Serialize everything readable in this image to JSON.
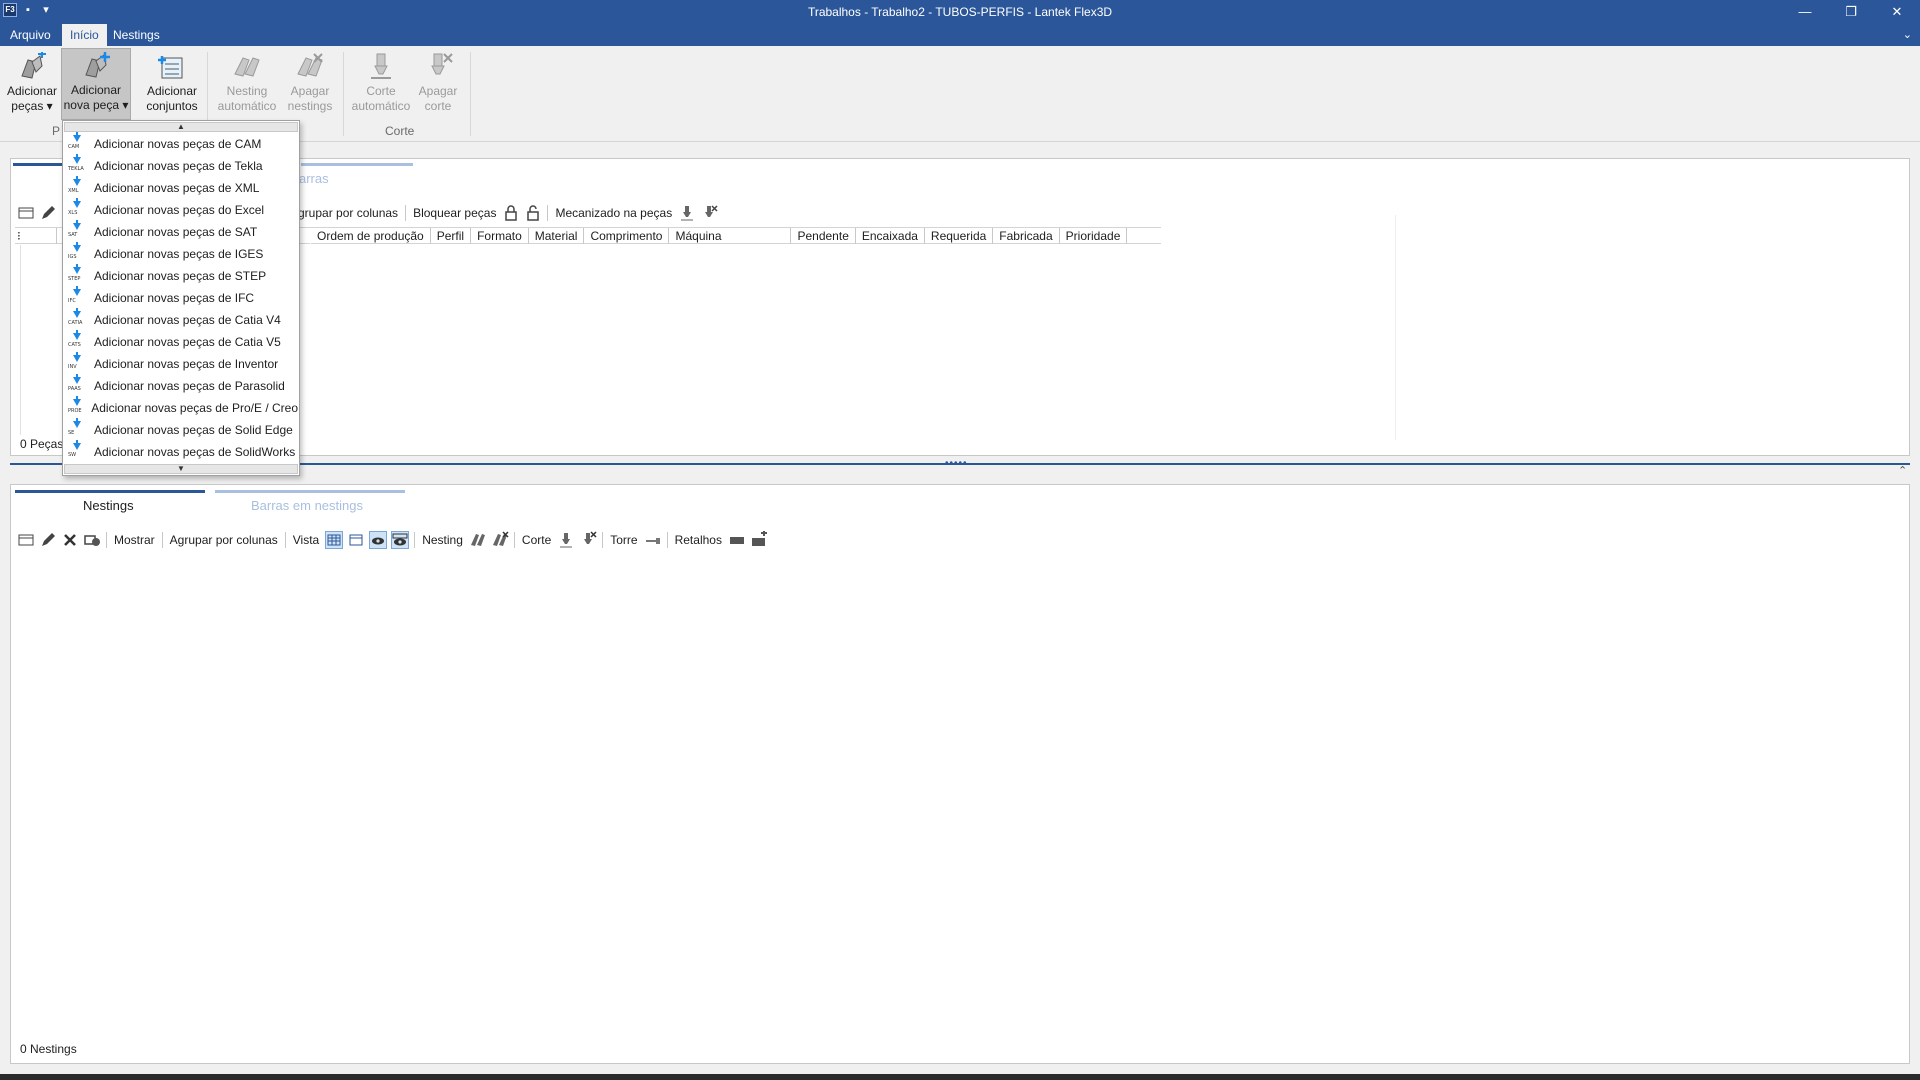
{
  "window": {
    "title": "Trabalhos - Trabalho2 - TUBOS-PERFIS - Lantek Flex3D",
    "app_icon_text": "F3"
  },
  "menu": {
    "tabs": [
      "Arquivo",
      "Início",
      "Nestings"
    ],
    "active": "Início"
  },
  "ribbon": {
    "add_parts": {
      "line1": "Adicionar",
      "line2": "peças ▾"
    },
    "add_new_part": {
      "line1": "Adicionar",
      "line2": "nova peça ▾"
    },
    "add_assemblies": {
      "line1": "Adicionar",
      "line2": "conjuntos"
    },
    "auto_nesting": {
      "line1": "Nesting",
      "line2": "automático"
    },
    "delete_nestings": {
      "line1": "Apagar",
      "line2": "nestings"
    },
    "auto_cut": {
      "line1": "Corte",
      "line2": "automático"
    },
    "delete_cut": {
      "line1": "Apagar",
      "line2": "corte"
    },
    "group_parts_label": "P",
    "group_cut_label": "Corte"
  },
  "parts_panel": {
    "tab2_partial": "arras",
    "toolbar": {
      "group_by_columns_partial": "grupar por colunas",
      "lock_parts": "Bloquear peças",
      "machined_in_parts": "Mecanizado na peças"
    },
    "columns": [
      "Ordem de produção",
      "Perfil",
      "Formato",
      "Material",
      "Comprimento",
      "Máquina",
      "Pendente",
      "Encaixada",
      "Requerida",
      "Fabricada",
      "Prioridade"
    ],
    "footer_partial": "0 Peças"
  },
  "dropdown": {
    "scroll_up": "▲",
    "scroll_down": "▼",
    "items": [
      {
        "label": "Adicionar novas peças de CAM",
        "tag": "CAM"
      },
      {
        "label": "Adicionar novas peças de Tekla",
        "tag": "TEKLA"
      },
      {
        "label": "Adicionar novas peças de XML",
        "tag": "XML"
      },
      {
        "label": "Adicionar novas peças do Excel",
        "tag": "XLS"
      },
      {
        "label": "Adicionar novas peças de SAT",
        "tag": "SAT"
      },
      {
        "label": "Adicionar novas peças de IGES",
        "tag": "IGS"
      },
      {
        "label": "Adicionar novas peças de STEP",
        "tag": "STEP"
      },
      {
        "label": "Adicionar novas peças de IFC",
        "tag": "IFC"
      },
      {
        "label": "Adicionar novas peças de Catia V4",
        "tag": "CATIA"
      },
      {
        "label": "Adicionar novas peças de Catia V5",
        "tag": "CATS"
      },
      {
        "label": "Adicionar novas peças de Inventor",
        "tag": "INV"
      },
      {
        "label": "Adicionar novas peças de Parasolid",
        "tag": "PAAS"
      },
      {
        "label": "Adicionar novas peças de Pro/E / Creo",
        "tag": "PROE"
      },
      {
        "label": "Adicionar novas peças de Solid Edge",
        "tag": "SE"
      },
      {
        "label": "Adicionar novas peças de SolidWorks",
        "tag": "SW"
      }
    ]
  },
  "nestings_panel": {
    "tabs": [
      "Nestings",
      "Barras em nestings"
    ],
    "toolbar": {
      "show": "Mostrar",
      "group_by_columns": "Agrupar por colunas",
      "view": "Vista",
      "nesting": "Nesting",
      "cut": "Corte",
      "tower": "Torre",
      "remnants": "Retalhos"
    },
    "footer": "0 Nestings"
  },
  "colors": {
    "accent": "#2b579a",
    "dropdown_icon": "#1e88e5"
  }
}
